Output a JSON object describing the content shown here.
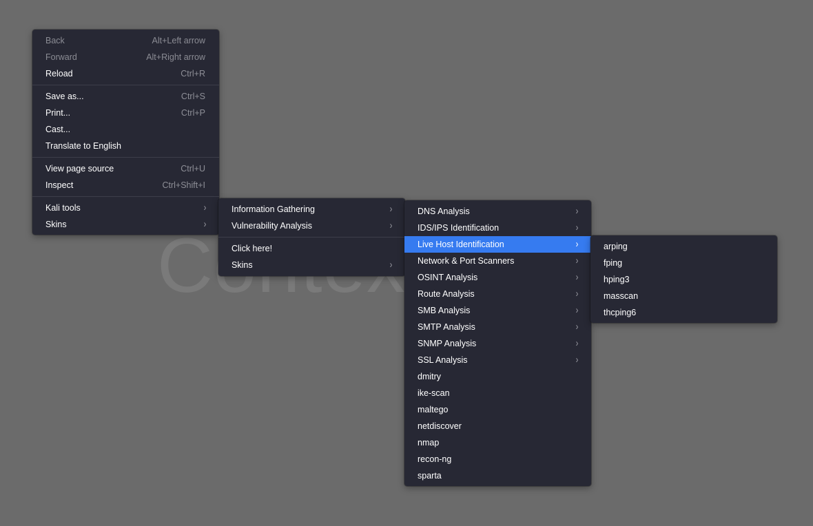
{
  "background": {
    "color": "#6b6b6b",
    "watermark_text": "Contextu"
  },
  "colors": {
    "menu_bg": "#272834",
    "highlight": "#367bf0",
    "text": "#ffffff",
    "muted": "#8e8f97"
  },
  "main_menu": {
    "back": {
      "label": "Back",
      "shortcut": "Alt+Left arrow"
    },
    "forward": {
      "label": "Forward",
      "shortcut": "Alt+Right arrow"
    },
    "reload": {
      "label": "Reload",
      "shortcut": "Ctrl+R"
    },
    "save_as": {
      "label": "Save as...",
      "shortcut": "Ctrl+S"
    },
    "print": {
      "label": "Print...",
      "shortcut": "Ctrl+P"
    },
    "cast": {
      "label": "Cast..."
    },
    "translate": {
      "label": "Translate to English"
    },
    "view_source": {
      "label": "View page source",
      "shortcut": "Ctrl+U"
    },
    "inspect": {
      "label": "Inspect",
      "shortcut": "Ctrl+Shift+I"
    },
    "kali_tools": {
      "label": "Kali tools",
      "icon": "chevron-right-icon"
    },
    "skins": {
      "label": "Skins",
      "icon": "chevron-right-icon"
    }
  },
  "kali_menu": {
    "information_gathering": "Information Gathering",
    "vulnerability_analysis": "Vulnerability Analysis",
    "click_here": "Click here!",
    "skins": "Skins"
  },
  "info_menu": {
    "items": [
      "DNS Analysis",
      "IDS/IPS Identification",
      "Live Host Identification",
      "Network & Port Scanners",
      "OSINT Analysis",
      "Route Analysis",
      "SMB Analysis",
      "SMTP Analysis",
      "SNMP Analysis",
      "SSL Analysis",
      "dmitry",
      "ike-scan",
      "maltego",
      "netdiscover",
      "nmap",
      "recon-ng",
      "sparta"
    ],
    "active_item": "Live Host Identification"
  },
  "live_menu": {
    "items": [
      "arping",
      "fping",
      "hping3",
      "masscan",
      "thcping6"
    ]
  },
  "chevron": "›"
}
